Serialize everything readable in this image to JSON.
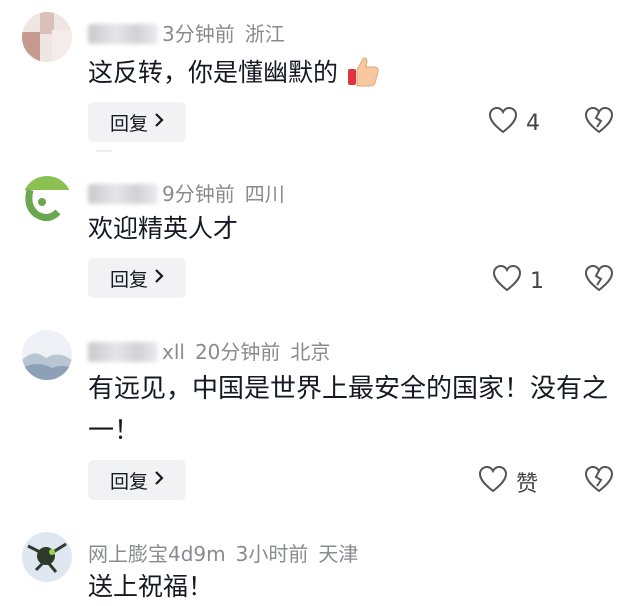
{
  "reply_label": "回复",
  "comments": [
    {
      "meta": {
        "name": "力学志法",
        "time": "3分钟前",
        "location": "浙江"
      },
      "text": "这反转，你是懂幽默的",
      "like_count": "4",
      "avatar_color": "#d8c8c4"
    },
    {
      "meta": {
        "name": "若渡",
        "time": "9分钟前",
        "location": "四川"
      },
      "text": "欢迎精英人才",
      "like_count": "1",
      "avatar_color": "#6aa84f"
    },
    {
      "meta": {
        "name": "xll",
        "time": "20分钟前",
        "location": "北京"
      },
      "text": "有远见，中国是世界上最安全的国家！没有之一！",
      "like_count": "赞",
      "avatar_color": "#c9d3de"
    },
    {
      "meta": {
        "name": "网上膨宝4d9m",
        "time": "3小时前",
        "location": "天津"
      },
      "text": "送上祝福！",
      "avatar_color": "#b7c7d9"
    }
  ],
  "icons": {
    "like": "heart-outline-icon",
    "dislike": "broken-heart-icon",
    "emoji": "thumbs-up-emoji"
  }
}
